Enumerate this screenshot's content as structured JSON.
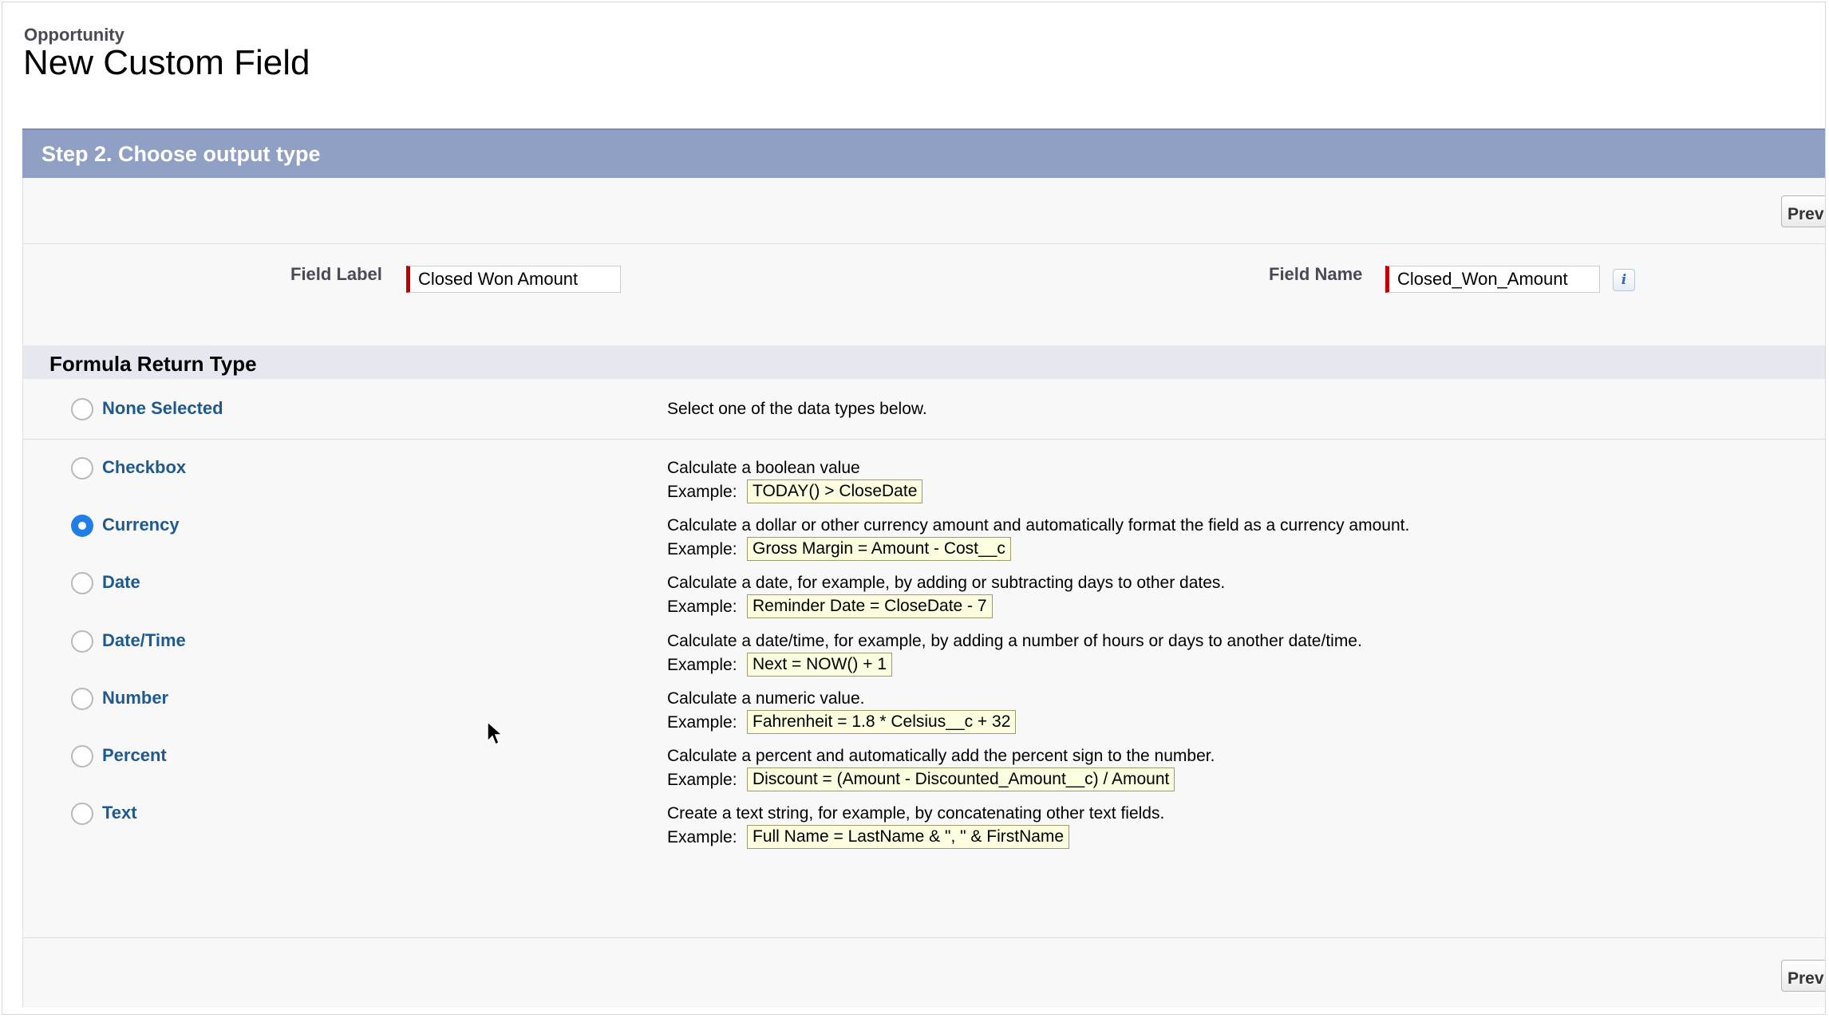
{
  "header": {
    "object_name": "Opportunity",
    "title": "New Custom Field"
  },
  "step": {
    "title": "Step 2. Choose output type"
  },
  "buttons": {
    "previous_label": "Prev"
  },
  "fields": {
    "field_label_caption": "Field Label",
    "field_label_value": "Closed Won Amount",
    "field_name_caption": "Field Name",
    "field_name_value": "Closed_Won_Amount",
    "info_icon": "i"
  },
  "section": {
    "title": "Formula Return Type"
  },
  "none_option": {
    "label": "None Selected",
    "description": "Select one of the data types below."
  },
  "example_caption": "Example:",
  "types": [
    {
      "label": "Checkbox",
      "checked": false,
      "description": "Calculate a boolean value",
      "example": "TODAY() > CloseDate"
    },
    {
      "label": "Currency",
      "checked": true,
      "description": "Calculate a dollar or other currency amount and automatically format the field as a currency amount.",
      "example": "Gross Margin = Amount - Cost__c"
    },
    {
      "label": "Date",
      "checked": false,
      "description": "Calculate a date, for example, by adding or subtracting days to other dates.",
      "example": "Reminder Date = CloseDate - 7"
    },
    {
      "label": "Date/Time",
      "checked": false,
      "description": "Calculate a date/time, for example, by adding a number of hours or days to another date/time.",
      "example": "Next = NOW() + 1"
    },
    {
      "label": "Number",
      "checked": false,
      "description": "Calculate a numeric value.",
      "example": "Fahrenheit = 1.8 * Celsius__c + 32"
    },
    {
      "label": "Percent",
      "checked": false,
      "description": "Calculate a percent and automatically add the percent sign to the number.",
      "example": "Discount = (Amount - Discounted_Amount__c) / Amount"
    },
    {
      "label": "Text",
      "checked": false,
      "description": "Create a text string, for example, by concatenating other text fields.",
      "example": "Full Name = LastName & \", \" & FirstName"
    }
  ],
  "colors": {
    "step_header": "#8fa0c4",
    "link_blue": "#1f5a8f",
    "radio_selected": "#1f7fe6",
    "required_marker": "#c00000"
  }
}
